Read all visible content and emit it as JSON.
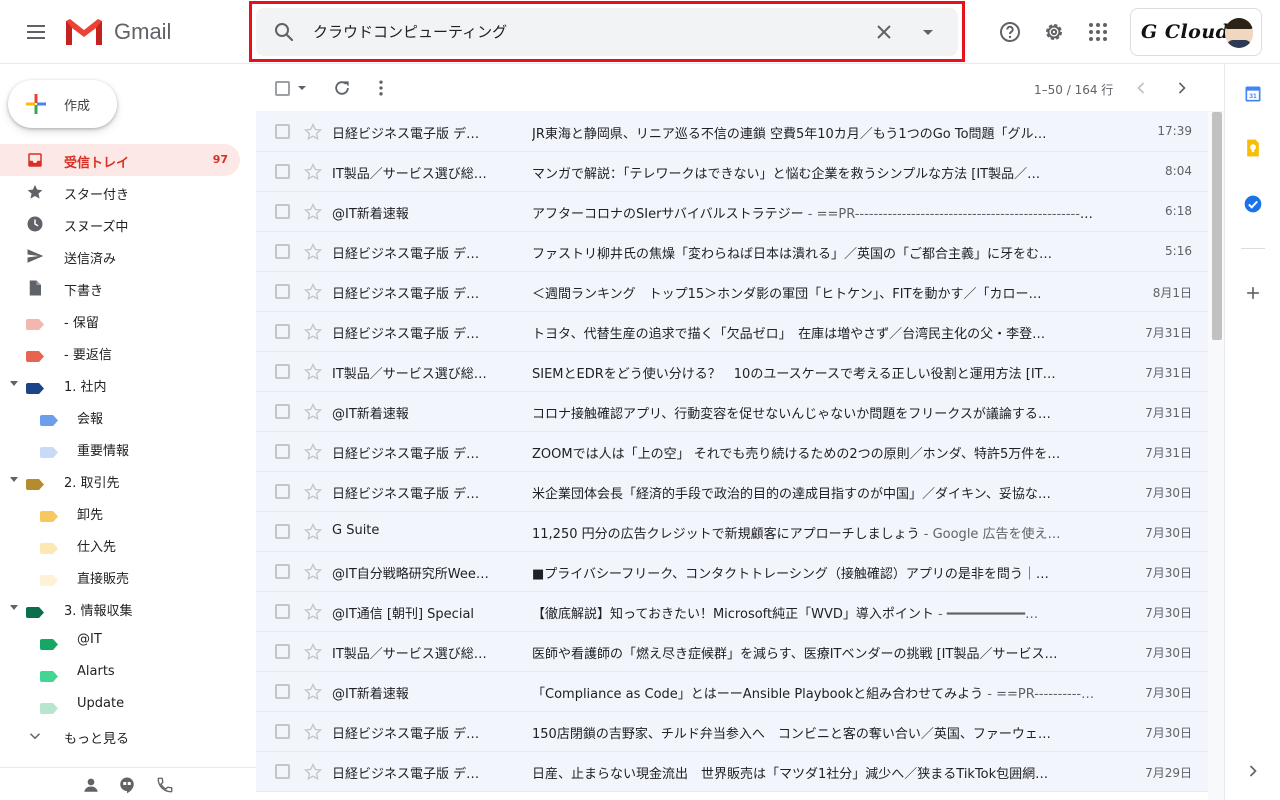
{
  "app": {
    "name": "Gmail"
  },
  "search": {
    "query": "クラウドコンピューティング"
  },
  "account": {
    "name": "G Cloud"
  },
  "compose": {
    "label": "作成"
  },
  "nav": [
    {
      "id": "inbox",
      "label": "受信トレイ",
      "count": "97",
      "icon": "inbox-icon",
      "active": true
    },
    {
      "id": "starred",
      "label": "スター付き",
      "icon": "star-icon"
    },
    {
      "id": "snoozed",
      "label": "スヌーズ中",
      "icon": "clock-icon"
    },
    {
      "id": "sent",
      "label": "送信済み",
      "icon": "send-icon"
    },
    {
      "id": "drafts",
      "label": "下書き",
      "icon": "draft-icon"
    },
    {
      "id": "hold",
      "label": "- 保留",
      "color": "#f4b6b0",
      "type": "label"
    },
    {
      "id": "reply",
      "label": "- 要返信",
      "color": "#e66550",
      "type": "label"
    },
    {
      "id": "internal",
      "label": "1. 社内",
      "color": "#1c4587",
      "type": "label",
      "caret": true
    },
    {
      "id": "kaiho",
      "label": "会報",
      "color": "#6d9eeb",
      "type": "sublabel"
    },
    {
      "id": "juyo",
      "label": "重要情報",
      "color": "#c9daf8",
      "type": "sublabel"
    },
    {
      "id": "partners",
      "label": "2. 取引先",
      "color": "#b58b2f",
      "type": "label",
      "caret": true
    },
    {
      "id": "oroshi",
      "label": "卸先",
      "color": "#f6c85f",
      "type": "sublabel"
    },
    {
      "id": "shiire",
      "label": "仕入先",
      "color": "#fce8b2",
      "type": "sublabel"
    },
    {
      "id": "chokusetsu",
      "label": "直接販売",
      "color": "#fef1d6",
      "type": "sublabel"
    },
    {
      "id": "info",
      "label": "3. 情報収集",
      "color": "#0b6e4f",
      "type": "label",
      "caret": true
    },
    {
      "id": "atit",
      "label": "@IT",
      "color": "#16a765",
      "type": "sublabel"
    },
    {
      "id": "alarts",
      "label": "Alarts",
      "color": "#43d692",
      "type": "sublabel"
    },
    {
      "id": "update",
      "label": "Update",
      "color": "#b9e4d0",
      "type": "sublabel"
    },
    {
      "id": "more",
      "label": "もっと見る",
      "icon": "chevron-down-icon"
    }
  ],
  "pager": {
    "text": "1–50 / 164 行"
  },
  "emails": [
    {
      "sender": "日経ビジネス電子版 デ…",
      "subject": "JR東海と静岡県、リニア巡る不信の連鎖 空費5年10カ月／もう1つのGo To問題「グル…",
      "snippet": "",
      "date": "17:39"
    },
    {
      "sender": "IT製品／サービス選び総…",
      "subject": "マンガで解説：「テレワークはできない」と悩む企業を救うシンプルな方法 [IT製品／…",
      "snippet": "",
      "date": "8:04"
    },
    {
      "sender": "@IT新着速報",
      "subject": "アフターコロナのSIerサバイバルストラテジー",
      "snippet": " - ==PR-------------------------------------------------…",
      "date": "6:18"
    },
    {
      "sender": "日経ビジネス電子版 デ…",
      "subject": "ファストリ柳井氏の焦燥「変わらねば日本は潰れる」／英国の「ご都合主義」に牙をむ…",
      "snippet": "",
      "date": "5:16"
    },
    {
      "sender": "日経ビジネス電子版 デ…",
      "subject": "＜週間ランキング　トップ15＞ホンダ影の軍団「ヒトケン」、FITを動かす／「カロー…",
      "snippet": "",
      "date": "8月1日"
    },
    {
      "sender": "日経ビジネス電子版 デ…",
      "subject": "トヨタ、代替生産の追求で描く「欠品ゼロ」　在庫は増やさず／台湾民主化の父・李登…",
      "snippet": "",
      "date": "7月31日"
    },
    {
      "sender": "IT製品／サービス選び総…",
      "subject": "SIEMとEDRをどう使い分ける？　10のユースケースで考える正しい役割と運用方法 [IT…",
      "snippet": "",
      "date": "7月31日"
    },
    {
      "sender": "@IT新着速報",
      "subject": "コロナ接触確認アプリ、行動変容を促せないんじゃないか問題をフリークスが議論する…",
      "snippet": "",
      "date": "7月31日"
    },
    {
      "sender": "日経ビジネス電子版 デ…",
      "subject": "ZOOMでは人は「上の空」 それでも売り続けるための2つの原則／ホンダ、特許5万件を…",
      "snippet": "",
      "date": "7月31日"
    },
    {
      "sender": "日経ビジネス電子版 デ…",
      "subject": "米企業団体会長「経済的手段で政治的目的の達成目指すのが中国」／ダイキン、妥協な…",
      "snippet": "",
      "date": "7月30日"
    },
    {
      "sender": "G Suite",
      "subject": "11,250 円分の広告クレジットで新規顧客にアプローチしましょう",
      "snippet": " - Google 広告を使え…",
      "date": "7月30日"
    },
    {
      "sender": "@IT自分戦略研究所Wee…",
      "subject": "■プライバシーフリーク、コンタクトトレーシング（接触確認）アプリの是非を問う｜…",
      "snippet": "",
      "date": "7月30日"
    },
    {
      "sender": "@IT通信 [朝刊] Special",
      "subject": "【徹底解説】知っておきたい！Microsoft純正「WVD」導入ポイント",
      "snippet": " - ━━━━━━━━━━…",
      "date": "7月30日"
    },
    {
      "sender": "IT製品／サービス選び総…",
      "subject": "医師や看護師の「燃え尽き症候群」を減らす、医療ITベンダーの挑戦 [IT製品／サービス…",
      "snippet": "",
      "date": "7月30日"
    },
    {
      "sender": "@IT新着速報",
      "subject": "「Compliance as Code」とはーーAnsible Playbookと組み合わせてみよう",
      "snippet": " - ==PR----------…",
      "date": "7月30日"
    },
    {
      "sender": "日経ビジネス電子版 デ…",
      "subject": "150店閉鎖の吉野家、チルド弁当参入へ　コンビニと客の奪い合い／英国、ファーウェ…",
      "snippet": "",
      "date": "7月30日"
    },
    {
      "sender": "日経ビジネス電子版 デ…",
      "subject": "日産、止まらない現金流出　世界販売は「マツダ1社分」減少へ／狭まるTikTok包囲網…",
      "snippet": "",
      "date": "7月29日"
    }
  ]
}
